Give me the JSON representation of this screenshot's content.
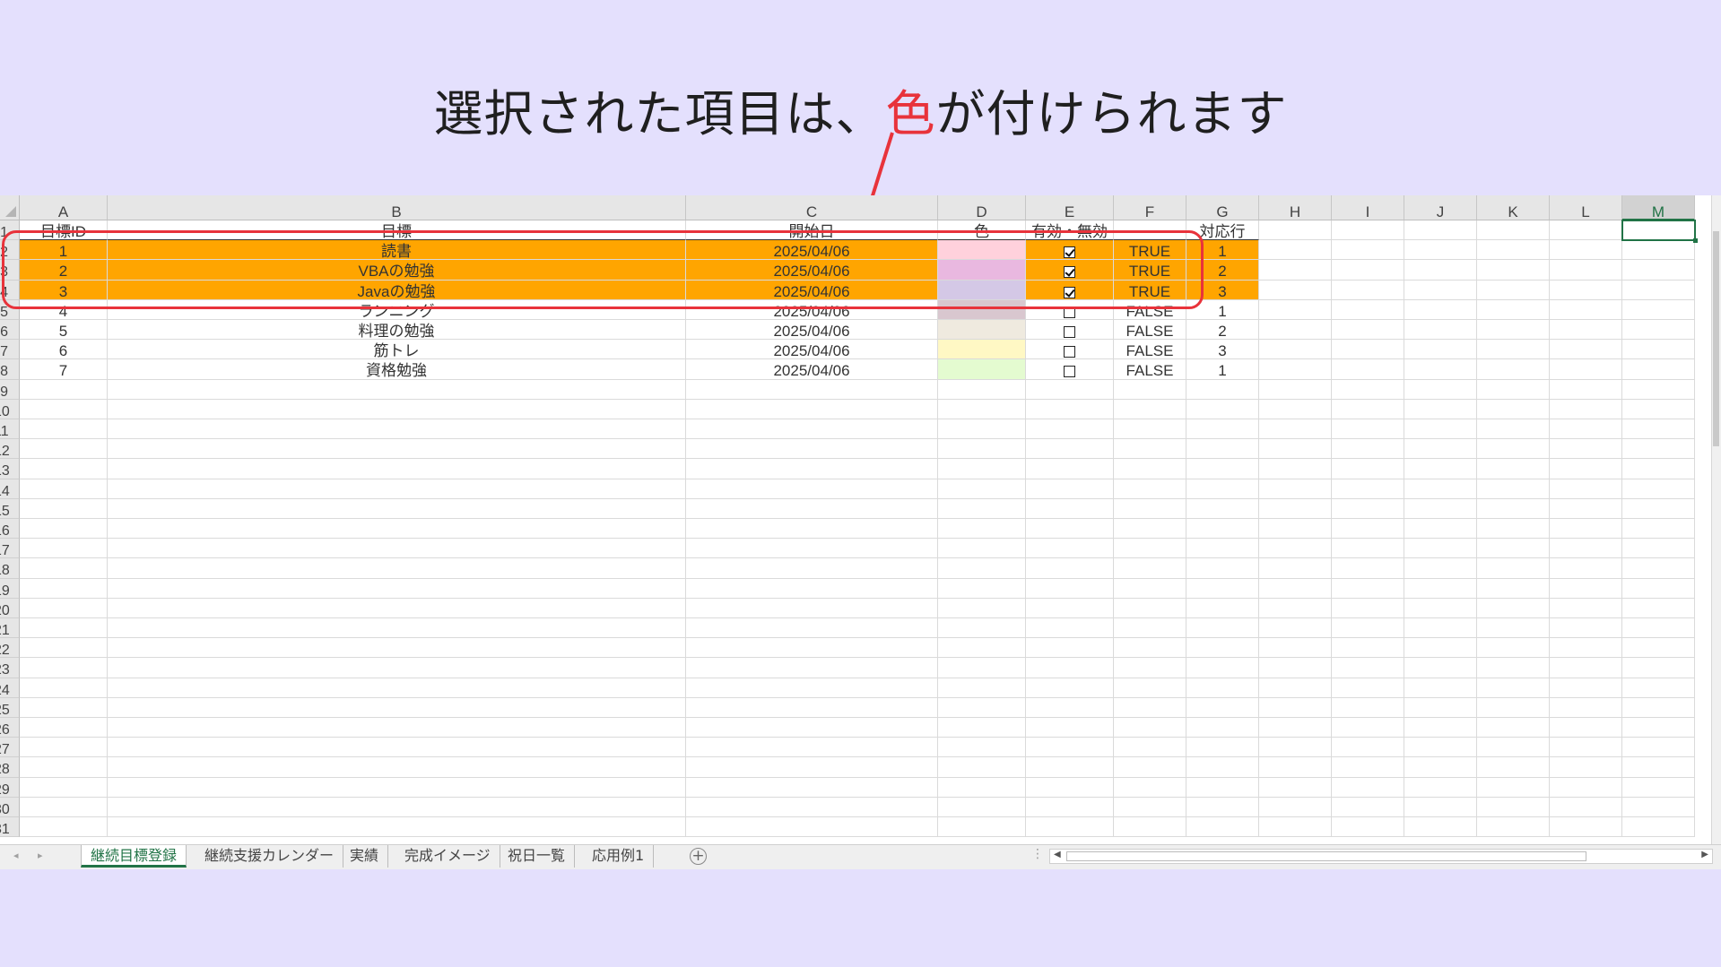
{
  "headline": {
    "before": "選択された項目は、",
    "highlight": "色",
    "after": "が付けられます"
  },
  "colors": {
    "background": "#e4e0fd",
    "highlight": "#ffa500",
    "annotation": "#e8333b",
    "excel_green": "#217346"
  },
  "columns": [
    "A",
    "B",
    "C",
    "D",
    "E",
    "F",
    "G",
    "H",
    "I",
    "J",
    "K",
    "L",
    "M"
  ],
  "selected_column": "M",
  "row_numbers": [
    "1",
    "2",
    "3",
    "4",
    "5",
    "6",
    "7",
    "8",
    "9",
    "10",
    "11",
    "12",
    "13",
    "14",
    "15",
    "16",
    "17",
    "18",
    "19",
    "20",
    "21",
    "22",
    "23",
    "24",
    "25",
    "26",
    "27",
    "28",
    "29",
    "30",
    "31"
  ],
  "table": {
    "headers": [
      "目標ID",
      "目標",
      "開始日",
      "色",
      "有効・無効",
      "",
      "対応行"
    ],
    "rows": [
      {
        "id": "1",
        "goal": "読書",
        "start": "2025/04/06",
        "color": "#ffd1dc",
        "checked": true,
        "flag": "TRUE",
        "row": "1",
        "highlighted": true
      },
      {
        "id": "2",
        "goal": "VBAの勉強",
        "start": "2025/04/06",
        "color": "#e9b8e0",
        "checked": true,
        "flag": "TRUE",
        "row": "2",
        "highlighted": true
      },
      {
        "id": "3",
        "goal": "Javaの勉強",
        "start": "2025/04/06",
        "color": "#d4c8e6",
        "checked": true,
        "flag": "TRUE",
        "row": "3",
        "highlighted": true
      },
      {
        "id": "4",
        "goal": "ランニング",
        "start": "2025/04/06",
        "color": "#d9c7cf",
        "checked": false,
        "flag": "FALSE",
        "row": "1",
        "highlighted": false
      },
      {
        "id": "5",
        "goal": "料理の勉強",
        "start": "2025/04/06",
        "color": "#efeadf",
        "checked": false,
        "flag": "FALSE",
        "row": "2",
        "highlighted": false
      },
      {
        "id": "6",
        "goal": "筋トレ",
        "start": "2025/04/06",
        "color": "#fff8c4",
        "checked": false,
        "flag": "FALSE",
        "row": "3",
        "highlighted": false
      },
      {
        "id": "7",
        "goal": "資格勉強",
        "start": "2025/04/06",
        "color": "#e4fbd0",
        "checked": false,
        "flag": "FALSE",
        "row": "1",
        "highlighted": false
      }
    ]
  },
  "sheet_tabs": [
    "継続目標登録",
    "継続支援カレンダー",
    "実績",
    "完成イメージ",
    "祝日一覧",
    "応用例1"
  ],
  "active_tab": "継続目標登録",
  "icons": {
    "add_sheet": "plus-circle-icon",
    "scroll_left": "triangle-left-icon",
    "scroll_right": "triangle-right-icon"
  }
}
